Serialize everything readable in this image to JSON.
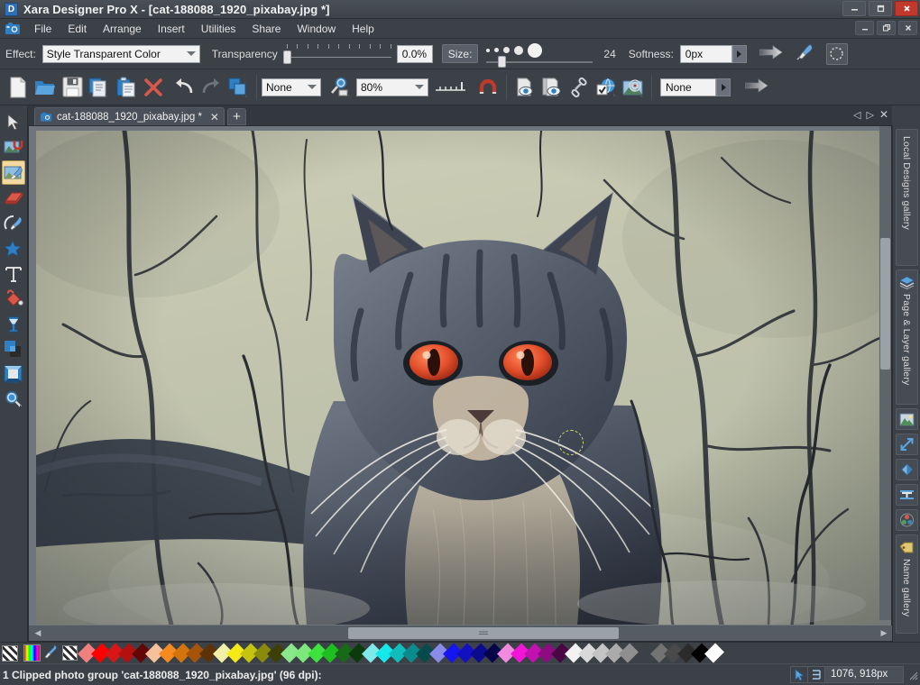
{
  "window": {
    "app_name": "Xara Designer Pro X",
    "logo_letter": "D",
    "title": "Xara Designer Pro X - [cat-188088_1920_pixabay.jpg *]",
    "controls": {
      "minimize": "—",
      "restore": "❐",
      "close": "✕"
    },
    "inner_controls": {
      "minimize": "—",
      "restore": "❐",
      "close": "✕"
    }
  },
  "menubar": {
    "camera_icon": "camera-icon",
    "items": [
      {
        "label": "File",
        "accel": "F"
      },
      {
        "label": "Edit",
        "accel": "E"
      },
      {
        "label": "Arrange",
        "accel": "r"
      },
      {
        "label": "Insert",
        "accel": "I"
      },
      {
        "label": "Utilities",
        "accel": "U"
      },
      {
        "label": "Share",
        "accel": "h"
      },
      {
        "label": "Window",
        "accel": "W"
      },
      {
        "label": "Help",
        "accel": "H"
      }
    ]
  },
  "infobar": {
    "effect_label": "Effect:",
    "effect_value": "Style Transparent Color",
    "transparency_label": "Transparency",
    "transparency_value": "0.0%",
    "size_label": "Size:",
    "size_value": "24",
    "softness_label": "Softness:",
    "softness_value": "0px",
    "arrow_icon": "gradient-arrow-icon",
    "brush_icon": "paint-brush-icon",
    "selection_icon": "marquee-selection-icon"
  },
  "toolbar": {
    "buttons": [
      {
        "name": "new-document",
        "icon": "page-icon"
      },
      {
        "name": "open-document",
        "icon": "folder-open-icon"
      },
      {
        "name": "save-document",
        "icon": "floppy-disk-icon"
      },
      {
        "name": "copy",
        "icon": "copy-icon"
      },
      {
        "name": "paste",
        "icon": "clipboard-paste-icon"
      },
      {
        "name": "delete",
        "icon": "red-x-icon"
      },
      {
        "name": "undo",
        "icon": "undo-arrow-icon"
      },
      {
        "name": "redo",
        "icon": "redo-arrow-icon"
      },
      {
        "name": "duplicate",
        "icon": "duplicate-shapes-icon"
      }
    ],
    "quality_value": "None",
    "zoom_tool_icon": "zoom-magnifier-icon",
    "zoom_value": "80%",
    "ruler_icon": "ruler-icon",
    "magnet_icon": "snap-magnet-icon",
    "preview_buttons": [
      {
        "name": "preview-page",
        "icon": "page-preview-eye-icon"
      },
      {
        "name": "preview-document",
        "icon": "document-preview-eye-icon"
      },
      {
        "name": "insert-link",
        "icon": "chain-link-icon"
      },
      {
        "name": "web-properties",
        "icon": "globe-check-icon"
      },
      {
        "name": "web-animation",
        "icon": "photo-target-icon"
      }
    ],
    "layer_value": "None",
    "export_icon": "gradient-arrow-icon"
  },
  "left_tools": [
    {
      "name": "selector-tool",
      "icon": "arrow-cursor-icon",
      "selected": false
    },
    {
      "name": "photo-tool",
      "icon": "photo-magnet-icon",
      "selected": false
    },
    {
      "name": "photo-edit-tool",
      "icon": "photo-brush-icon",
      "selected": true
    },
    {
      "name": "eraser-tool",
      "icon": "eraser-icon",
      "selected": false
    },
    {
      "name": "freehand-tool",
      "icon": "freehand-pen-icon",
      "selected": false
    },
    {
      "name": "shape-tool",
      "icon": "star-shape-icon",
      "selected": false
    },
    {
      "name": "text-tool",
      "icon": "text-T-icon",
      "selected": false
    },
    {
      "name": "fill-tool",
      "icon": "paint-bucket-icon",
      "selected": false
    },
    {
      "name": "transparency-tool",
      "icon": "wine-glass-transparency-icon",
      "selected": false
    },
    {
      "name": "shadow-tool",
      "icon": "shadow-layers-icon",
      "selected": false
    },
    {
      "name": "bevel-tool",
      "icon": "bevel-frame-icon",
      "selected": false
    },
    {
      "name": "zoom-tool",
      "icon": "magnifier-icon",
      "selected": false
    }
  ],
  "tabs": {
    "items": [
      {
        "label": "cat-188088_1920_pixabay.jpg *",
        "icon": "camera-icon",
        "close": "✕",
        "active": true
      }
    ],
    "add_label": "+",
    "nav_prev": "◁",
    "nav_next": "▷",
    "nav_close": "✕"
  },
  "canvas": {
    "image_alt": "photo of a tabby cat with red eyes in snowy brush",
    "brush_cursor": "round-brush-cursor"
  },
  "galleries": [
    {
      "name": "local-designs-gallery",
      "label": "Local Designs gallery",
      "icon": "designs-icon"
    },
    {
      "name": "page-layer-gallery",
      "label": "Page & Layer gallery",
      "icon": "layers-stack-icon"
    },
    {
      "name": "bitmap-gallery",
      "label": "",
      "icon": "bitmap-image-icon"
    },
    {
      "name": "line-gallery",
      "label": "",
      "icon": "line-arrow-icon"
    },
    {
      "name": "fill-gallery",
      "label": "",
      "icon": "fill-diamond-icon"
    },
    {
      "name": "font-gallery",
      "label": "",
      "icon": "font-T-icon"
    },
    {
      "name": "color-gallery",
      "label": "",
      "icon": "color-wheel-icon"
    },
    {
      "name": "name-gallery",
      "label": "Name gallery",
      "icon": "tag-label-icon"
    }
  ],
  "colorbar": {
    "no-color_icon": "no-color-icon",
    "editor_icon": "color-editor-icon",
    "picker_icon": "eyedropper-icon",
    "transparent_icon": "transparent-checker-icon",
    "swatches": [
      "#f08080",
      "#ff0000",
      "#d81616",
      "#b51010",
      "#620606",
      "#f5c19b",
      "#f58b1f",
      "#d4740e",
      "#a6540a",
      "#5c3206",
      "#f2f0a8",
      "#f5ea15",
      "#c6c40f",
      "#8a8a0b",
      "#3e3f06",
      "#8ae88a",
      "#7ee87e",
      "#3ee23e",
      "#1fbf1f",
      "#176b17",
      "#0c3a0c",
      "#7fe8e8",
      "#15e8e8",
      "#10bcbc",
      "#0b8b8b",
      "#064a4a",
      "#8a8ae8",
      "#1515f2",
      "#1111c2",
      "#0b0b8f",
      "#050549",
      "#f28ae0",
      "#f215d8",
      "#c211b0",
      "#8f0b82",
      "#4a0543",
      "#f2f2f2",
      "#d9d9d9",
      "#c4c4c4",
      "#ababab",
      "#8f8f8f",
      "#737373",
      "#4a4a4a",
      "#2b2b2b",
      "#000000",
      "#ffffff"
    ]
  },
  "statusbar": {
    "message": "1 Clipped photo group 'cat-188088_1920_pixabay.jpg' (96 dpi):",
    "cursor_icon": "arrow-cursor-icon",
    "mode_icon": "snap-indicator-icon",
    "coordinates": "1076, 918px"
  }
}
